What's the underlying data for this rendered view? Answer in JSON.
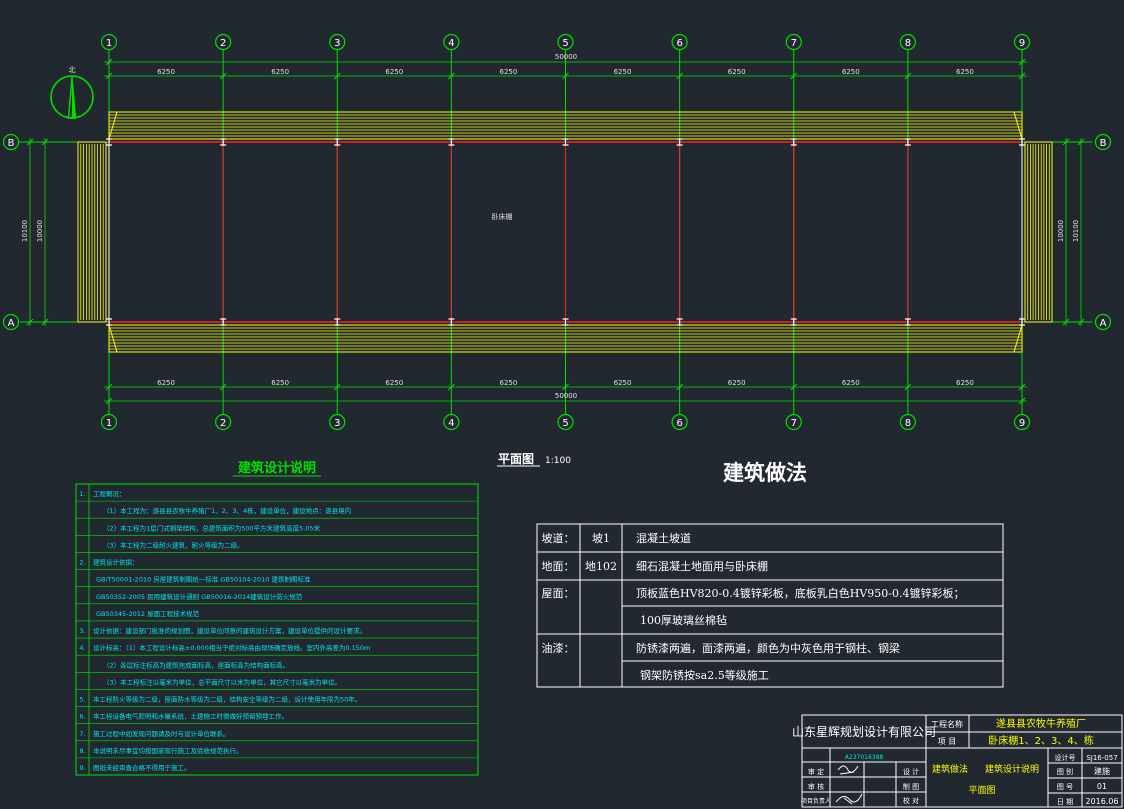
{
  "plan": {
    "axis_numbers": [
      "1",
      "2",
      "3",
      "4",
      "5",
      "6",
      "7",
      "8",
      "9"
    ],
    "row_left": [
      "B",
      "A"
    ],
    "row_right": [
      "B",
      "A"
    ],
    "bay_dims_top": [
      "6250",
      "6250",
      "6250",
      "6250",
      "6250",
      "6250",
      "6250",
      "6250"
    ],
    "bay_dims_bottom": [
      "6250",
      "6250",
      "6250",
      "6250",
      "6250",
      "6250",
      "6250",
      "6250"
    ],
    "total_dim_top": "50000",
    "total_dim_bottom": "50000",
    "side_dim_outer": "10100",
    "side_dim_inner": "10000",
    "room_label": "卧床棚",
    "north_label": "北",
    "title": "平面图",
    "scale": "1:100"
  },
  "notes": {
    "title": "建筑设计说明",
    "lines": [
      "1. 工程概况：",
      "（1）本工程为：遂县县农牧牛养殖厂1、2、3、4栋，建设单位，建设地点：遂县境内",
      "（2）本工程为1层门式钢架结构，总建筑面积为500平方米建筑高度5.05米",
      "（3）本工程为二级耐火建筑，耐火等级为二级。",
      "2. 建筑设计依据：",
      "GB/T50001-2010 房屋建筑制图统一标准        GB50104-2010 建筑制图标准",
      "GB50352-2005 民用建筑设计通则        GB50016-2014建筑设计防火规范",
      "GB50345-2012 屋面工程技术规范",
      "3. 设计依据：建设部门批准的规划图，建设单位同意的建筑设计方案，建设单位提供的设计要求。",
      "4. 设计标高：（1）本工程设计标高±0.000相当于绝对标高由现场确定放线。室内外高差为0.150m",
      "（2）各层标注标高为建筑完成面标高，屋面标高为结构面标高。",
      "（3）本工程标注以毫米为单位，总平面尺寸以米为单位，其它尺寸以毫米为单位。",
      "5. 本工程防火等级为二级，屋面防水等级为二级，结构安全等级为二级，设计使用年限为50年。",
      "6. 本工程设备电气照明和水暖系统，土建施工时需做好预留预埋工作。",
      "7. 施工过程中如发现问题请及时与设计单位联系。",
      "8. 本说明未尽事宜均按国家现行施工及验收规范执行。",
      "9. 图纸未经审查合格不得用于施工。"
    ]
  },
  "methods": {
    "title": "建筑做法",
    "rows": [
      {
        "part": "坡道：",
        "code": "坡1",
        "desc": "混凝土坡道"
      },
      {
        "part": "地面：",
        "code": "地102",
        "desc": "细石混凝土地面用与卧床棚"
      },
      {
        "part": "屋面：",
        "code": "",
        "desc": "顶板蓝色HV820-0.4镀锌彩板，底板乳白色HV950-0.4镀锌彩板；"
      },
      {
        "part": "",
        "code": "",
        "desc": "100厚玻璃丝棉毡"
      },
      {
        "part": "油漆：",
        "code": "",
        "desc": "防锈漆两遍，面漆两遍，颜色为中灰色用于钢柱、钢梁"
      },
      {
        "part": "",
        "code": "",
        "desc": "钢架防锈按sa2.5等级施工"
      }
    ]
  },
  "titleblock": {
    "company": "山东星辉规划设计有限公司",
    "company_code": "A237016388",
    "project_name_label": "工程名称",
    "project_name": "遂县县农牧牛养殖厂",
    "item_label": "项  目",
    "item": "卧床棚1、2、3、4、栋",
    "role_review": "审 定",
    "role_check": "审 核",
    "role_lead": "项目负责人",
    "role_design": "设 计",
    "role_draw": "制 图",
    "role_proof": "校 对",
    "drawing_title_1": "建筑做法",
    "drawing_title_2": "建筑设计说明",
    "drawing_title_3": "平面图",
    "design_no_label": "设计号",
    "design_no": "SJ16-057",
    "category_label": "图 别",
    "category": "建施",
    "sheet_label": "图 号",
    "sheet": "01",
    "date_label": "日 期",
    "date": "2016.06"
  },
  "colors": {
    "background": "#212830",
    "axis_green": "#00e000",
    "roof_yellow": "#ffff00",
    "beam_red": "#ff2020",
    "table_white": "#ffffff",
    "cyan": "#00e6e6"
  }
}
